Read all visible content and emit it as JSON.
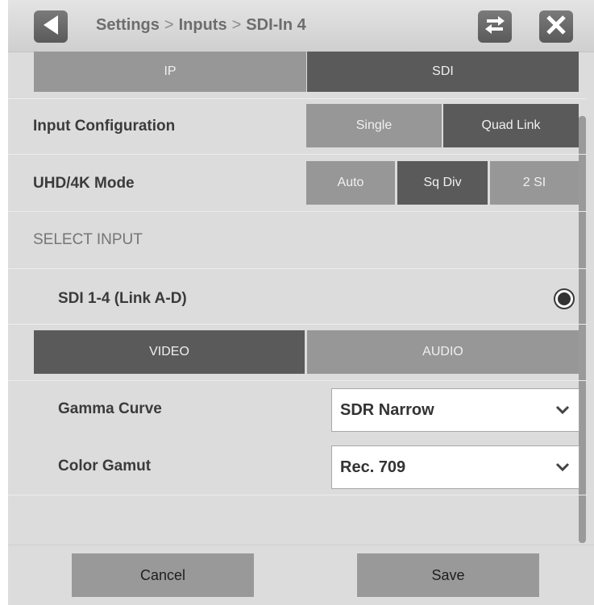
{
  "header": {
    "breadcrumb": [
      "Settings",
      "Inputs",
      "SDI-In 4"
    ],
    "separator": ">",
    "icons": [
      "back-arrow-icon",
      "swap-icon",
      "close-icon"
    ]
  },
  "interface_tabs": {
    "ip": "IP",
    "sdi": "SDI",
    "selected": "SDI"
  },
  "input_configuration": {
    "label": "Input Configuration",
    "options": [
      "Single",
      "Quad Link"
    ],
    "selected": "Quad Link"
  },
  "uhd_mode": {
    "label": "UHD/4K Mode",
    "options": [
      "Auto",
      "Sq Div",
      "2 SI"
    ],
    "selected": "Sq Div"
  },
  "select_input": {
    "heading": "SELECT INPUT",
    "item_label": "SDI 1-4 (Link A-D)",
    "checked": true
  },
  "media_tabs": {
    "video": "VIDEO",
    "audio": "AUDIO",
    "selected": "VIDEO"
  },
  "gamma_curve": {
    "label": "Gamma Curve",
    "value": "SDR Narrow"
  },
  "color_gamut": {
    "label": "Color Gamut",
    "value": "Rec. 709"
  },
  "footer": {
    "cancel_label": "Cancel",
    "save_label": "Save"
  },
  "colors": {
    "selected": "#5a5a5a",
    "unselected": "#979797",
    "background": "#dcdcdc"
  }
}
